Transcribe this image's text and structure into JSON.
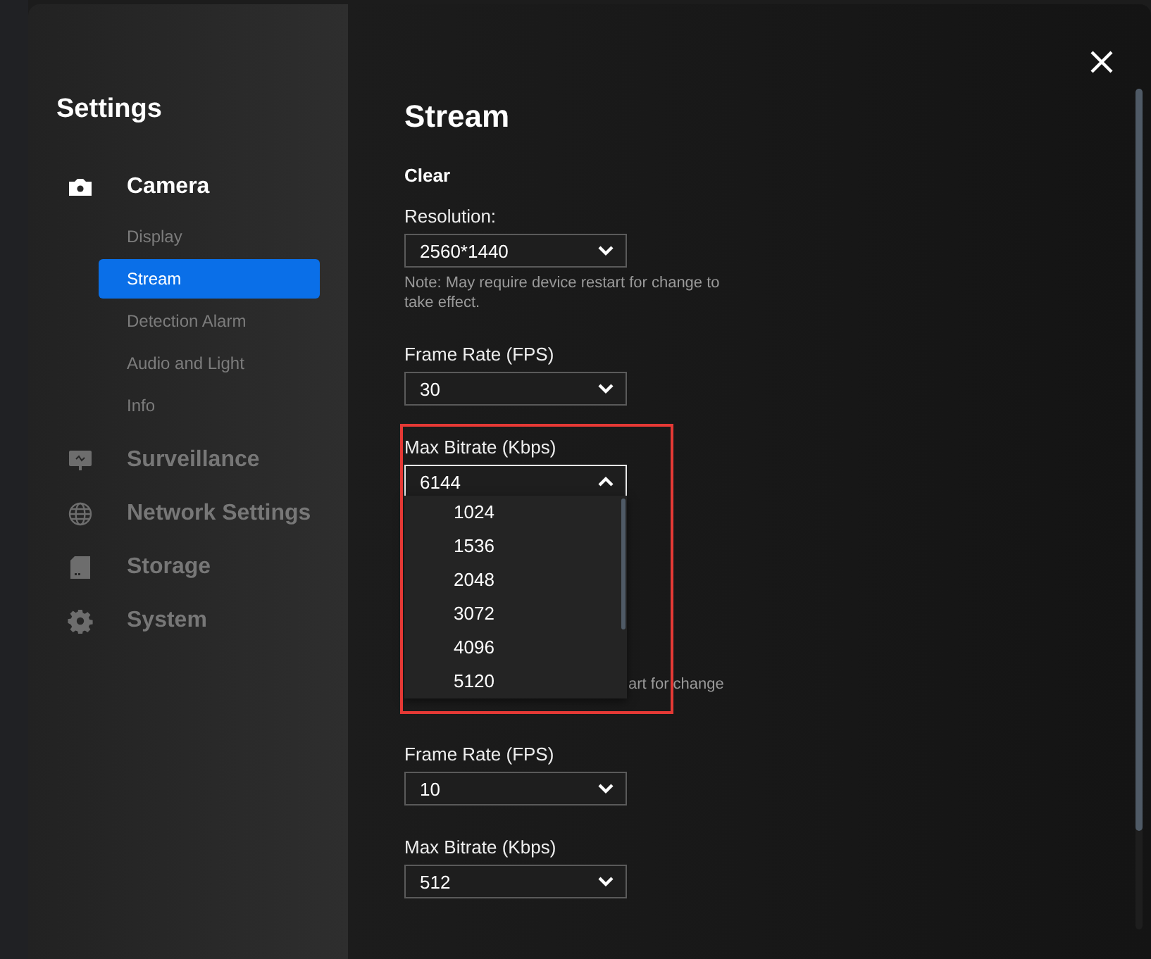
{
  "sidebar": {
    "title": "Settings",
    "categories": [
      {
        "label": "Camera",
        "kind": "camera",
        "selected": true,
        "children": [
          {
            "label": "Display",
            "selected": false
          },
          {
            "label": "Stream",
            "selected": true
          },
          {
            "label": "Detection Alarm",
            "selected": false
          },
          {
            "label": "Audio and Light",
            "selected": false
          },
          {
            "label": "Info",
            "selected": false
          }
        ]
      },
      {
        "label": "Surveillance",
        "kind": "monitor",
        "selected": false
      },
      {
        "label": "Network Settings",
        "kind": "globe",
        "selected": false
      },
      {
        "label": "Storage",
        "kind": "storage",
        "selected": false
      },
      {
        "label": "System",
        "kind": "gear",
        "selected": false
      }
    ]
  },
  "content": {
    "title": "Stream",
    "section": "Clear",
    "fields": [
      {
        "label": "Resolution:",
        "value": "2560*1440",
        "open": false,
        "highlighted": false,
        "note": "Note: May require device restart for change to take effect."
      },
      {
        "label": "Frame Rate (FPS)",
        "value": "30",
        "open": false,
        "highlighted": false
      },
      {
        "label": "Max Bitrate (Kbps)",
        "value": "6144",
        "open": true,
        "highlighted": true,
        "options": [
          "1024",
          "1536",
          "2048",
          "3072",
          "4096",
          "5120"
        ],
        "covered_note": "art for change"
      },
      {
        "label": "Frame Rate (FPS)",
        "value": "10",
        "open": false,
        "highlighted": false
      },
      {
        "label": "Max Bitrate (Kbps)",
        "value": "512",
        "open": false,
        "highlighted": false
      }
    ]
  }
}
